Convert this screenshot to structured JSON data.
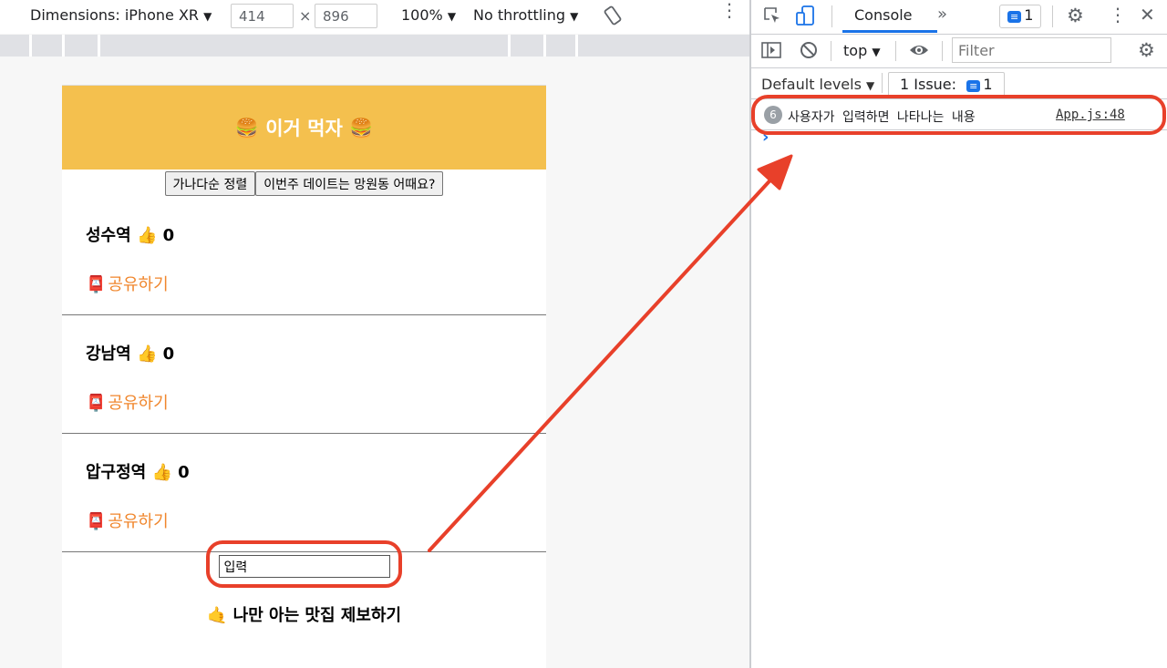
{
  "device_toolbar": {
    "dimensions_label": "Dimensions: iPhone XR",
    "width_value": "414",
    "times": "×",
    "height_value": "896",
    "zoom": "100%",
    "throttling": "No throttling"
  },
  "app": {
    "header_title": "🍔 이거 먹자 🍔",
    "sort_button": "가나다순 정렬",
    "date_button": "이번주 데이트는 망원동 어때요?",
    "places": [
      {
        "title": "성수역 👍 0",
        "share": "공유하기"
      },
      {
        "title": "강남역 👍 0",
        "share": "공유하기"
      },
      {
        "title": "압구정역 👍 0",
        "share": "공유하기"
      }
    ],
    "input_value": "입력",
    "submit_text": "🤙 나만 아는 맛집 제보하기"
  },
  "devtools": {
    "tab_console": "Console",
    "issues_count": "1",
    "context": "top",
    "filter_placeholder": "Filter",
    "default_levels": "Default levels",
    "issue_label": "1 Issue:",
    "issue_count": "1",
    "log_count": "6",
    "log_message": "사용자가 입력하면 나타나는 내용",
    "log_source": "App.js:48",
    "prompt": "›"
  },
  "colors": {
    "header_bg": "#f4c04e",
    "share_text": "#f0862c",
    "annotation": "#e8402a",
    "accent_blue": "#1a73e8"
  }
}
